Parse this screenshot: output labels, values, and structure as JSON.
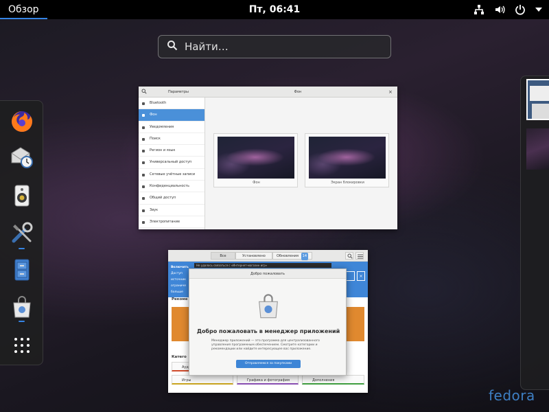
{
  "topbar": {
    "activities_label": "Обзор",
    "clock": "Пт, 06:41",
    "tray_icons": [
      "network-wired-icon",
      "volume-icon",
      "power-icon",
      "arrow-down-icon"
    ]
  },
  "search": {
    "placeholder": "Найти…"
  },
  "dash": {
    "apps": [
      {
        "name": "Firefox",
        "icon": "firefox-icon"
      },
      {
        "name": "Evolution",
        "icon": "mail-clock-icon"
      },
      {
        "name": "Rhythmbox",
        "icon": "speaker-icon"
      },
      {
        "name": "Settings",
        "icon": "tools-icon",
        "running": true
      },
      {
        "name": "Files",
        "icon": "filing-cabinet-icon"
      },
      {
        "name": "Software",
        "icon": "software-bag-icon",
        "running": true
      }
    ],
    "show_apps_icon": "grid-icon"
  },
  "settings_window": {
    "sidebar_title": "Параметры",
    "panel_title": "Фон",
    "sidebar_items": [
      "Bluetooth",
      "Фон",
      "Уведомления",
      "Поиск",
      "Регион и язык",
      "Универсальный доступ",
      "Сетевые учётные записи",
      "Конфиденциальность",
      "Общий доступ",
      "Звук",
      "Электропитание"
    ],
    "active_index": 1,
    "cards": [
      {
        "caption": "Фон"
      },
      {
        "caption": "Экран блокировки"
      }
    ],
    "close_glyph": "×"
  },
  "software_window": {
    "tabs": [
      "Все",
      "Установлено",
      "Обновления"
    ],
    "updates_badge": "14",
    "notice": "Не удалось связаться с «Интернет-магазин игр»",
    "banner_lines": [
      "Включить",
      "Доступ",
      "источник",
      "ограниче",
      "больше"
    ],
    "section_recommended": "Рекоме",
    "section_categories": "Катего",
    "categories": [
      "Ауд",
      "Игры",
      "Графика и фотография",
      "Дополнения"
    ],
    "dialog": {
      "header": "Добро пожаловать",
      "title": "Добро пожаловать в менеджер приложений",
      "text": "Менеджер приложений — это программа для централизованного управления программным обеспечением. Смотрите категории и рекомендации или найдите интересующее вас приложение.",
      "button": "Отправляемся за покупками"
    }
  },
  "brand": {
    "name": "fedora"
  },
  "colors": {
    "accent": "#3584e4",
    "fedora_blue": "#3e7fc4"
  }
}
